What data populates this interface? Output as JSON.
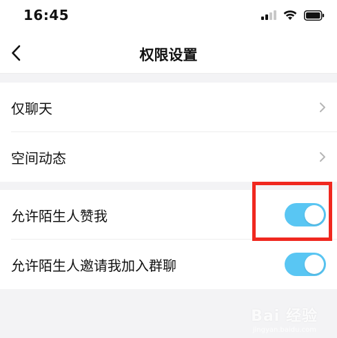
{
  "status_bar": {
    "time": "16:45",
    "icons": [
      "cellular-signal-icon",
      "wifi-icon",
      "battery-icon"
    ]
  },
  "nav": {
    "title": "权限设置",
    "back_icon": "chevron-left-icon"
  },
  "groups": [
    {
      "items": [
        {
          "label": "仅聊天",
          "type": "navigation",
          "icon": "chevron-right-icon"
        },
        {
          "label": "空间动态",
          "type": "navigation",
          "icon": "chevron-right-icon"
        }
      ]
    },
    {
      "items": [
        {
          "label": "允许陌生人赞我",
          "type": "toggle",
          "state": "on"
        },
        {
          "label": "允许陌生人邀请我加入群聊",
          "type": "toggle",
          "state": "on"
        }
      ]
    }
  ],
  "annotation": {
    "highlight_color": "#f0281f",
    "target": "允许陌生人赞我"
  },
  "watermark": {
    "text": "Bai 经验",
    "subtext": "jingyan.baidu.com"
  },
  "colors": {
    "toggle_on": "#59c6f3",
    "page_background": "#f3f3f5",
    "surface": "#ffffff"
  }
}
